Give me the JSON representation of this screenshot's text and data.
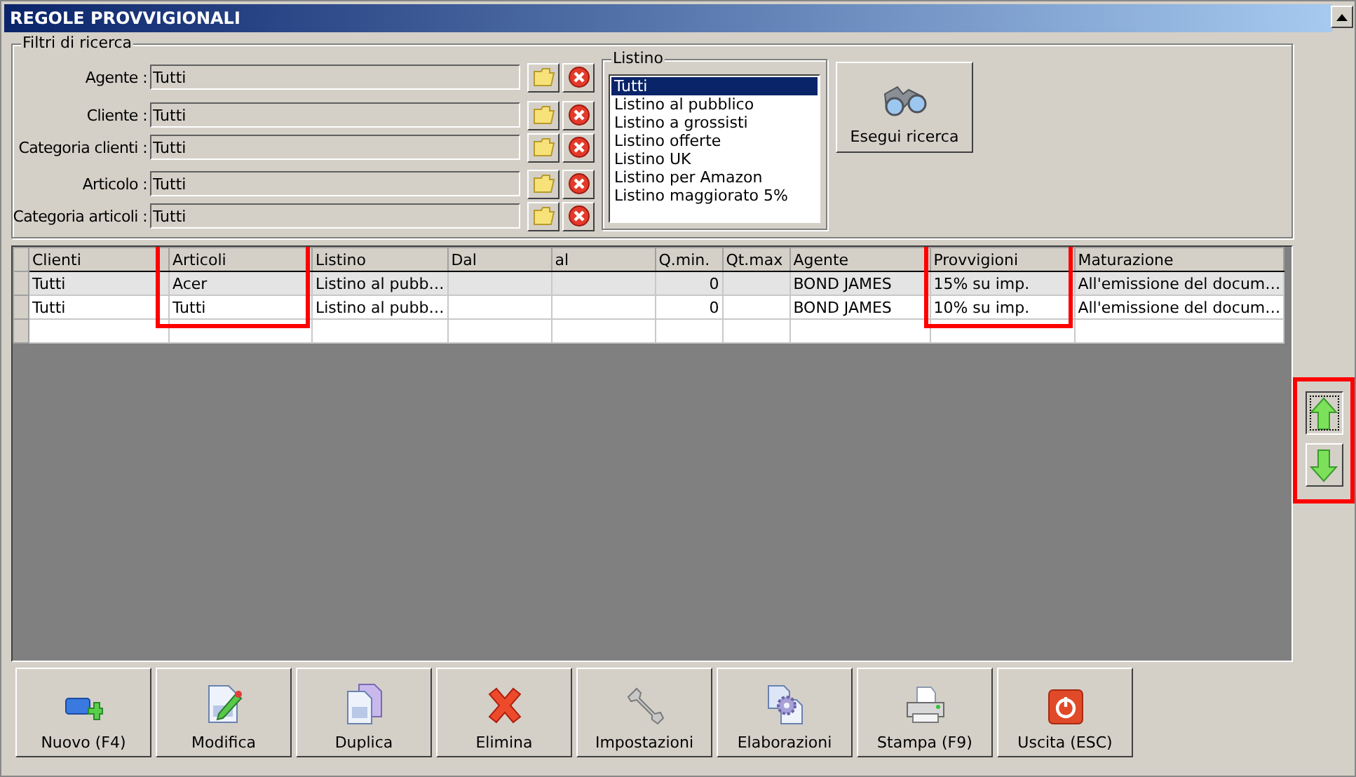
{
  "window": {
    "title": "REGOLE PROVVIGIONALI"
  },
  "filters": {
    "title": "Filtri di ricerca",
    "fields": [
      {
        "label": "Agente :",
        "value": "Tutti"
      },
      {
        "label": "Cliente :",
        "value": "Tutti"
      },
      {
        "label": "Categoria clienti :",
        "value": "Tutti"
      },
      {
        "label": "Articolo :",
        "value": "Tutti"
      },
      {
        "label": "Categoria articoli :",
        "value": "Tutti"
      }
    ]
  },
  "listino": {
    "title": "Listino",
    "items": [
      {
        "label": "Tutti",
        "selected": true
      },
      {
        "label": "Listino al pubblico",
        "selected": false
      },
      {
        "label": "Listino a grossisti",
        "selected": false
      },
      {
        "label": "Listino offerte",
        "selected": false
      },
      {
        "label": "Listino UK",
        "selected": false
      },
      {
        "label": "Listino per Amazon",
        "selected": false
      },
      {
        "label": "Listino maggiorato 5%",
        "selected": false
      }
    ]
  },
  "search_button": {
    "label": "Esegui ricerca"
  },
  "table": {
    "columns": [
      {
        "label": "Clienti",
        "highlighted": false
      },
      {
        "label": "Articoli",
        "highlighted": true
      },
      {
        "label": "Listino",
        "highlighted": false
      },
      {
        "label": "Dal",
        "highlighted": false
      },
      {
        "label": "al",
        "highlighted": false
      },
      {
        "label": "Q.min.",
        "highlighted": false
      },
      {
        "label": "Qt.max",
        "highlighted": false
      },
      {
        "label": "Agente",
        "highlighted": false
      },
      {
        "label": "Provvigioni",
        "highlighted": true
      },
      {
        "label": "Maturazione",
        "highlighted": false
      }
    ],
    "rows": [
      {
        "selected": true,
        "cells": [
          "Tutti",
          "Acer",
          "Listino al pubb…",
          "",
          "",
          "0",
          "",
          "BOND JAMES",
          "15% su imp.",
          "All'emissione del docum…"
        ]
      },
      {
        "selected": false,
        "cells": [
          "Tutti",
          "Tutti",
          "Listino al pubb…",
          "",
          "",
          "0",
          "",
          "BOND JAMES",
          "10% su imp.",
          "All'emissione del docum…"
        ]
      }
    ]
  },
  "reorder": {
    "highlighted": true
  },
  "buttons": [
    {
      "kind": "new",
      "label": "Nuovo (F4)"
    },
    {
      "kind": "edit",
      "label": "Modifica"
    },
    {
      "kind": "copy",
      "label": "Duplica"
    },
    {
      "kind": "delete",
      "label": "Elimina"
    },
    {
      "kind": "settings",
      "label": "Impostazioni"
    },
    {
      "kind": "process",
      "label": "Elaborazioni"
    },
    {
      "kind": "print",
      "label": "Stampa (F9)"
    },
    {
      "kind": "exit",
      "label": "Uscita (ESC)"
    }
  ]
}
